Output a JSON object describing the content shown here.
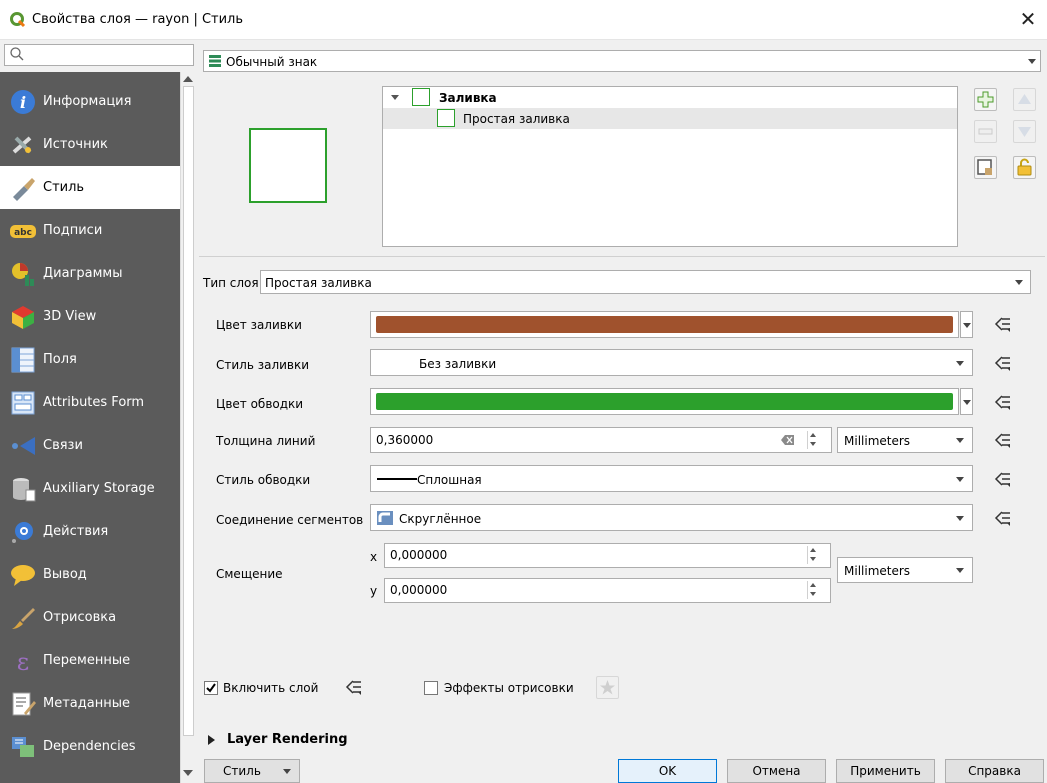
{
  "window": {
    "title": "Свойства слоя — rayon | Стиль",
    "close_glyph": "✕"
  },
  "search": {
    "placeholder": ""
  },
  "sidebar": {
    "items": [
      {
        "label": "Информация",
        "icon": "info-icon"
      },
      {
        "label": "Источник",
        "icon": "source-icon"
      },
      {
        "label": "Стиль",
        "icon": "paintbrush-icon",
        "active": true
      },
      {
        "label": "Подписи",
        "icon": "abc-labels-icon"
      },
      {
        "label": "Диаграммы",
        "icon": "diagram-icon"
      },
      {
        "label": "3D View",
        "icon": "cube-3d-icon"
      },
      {
        "label": "Поля",
        "icon": "fields-icon"
      },
      {
        "label": "Attributes Form",
        "icon": "form-icon"
      },
      {
        "label": "Связи",
        "icon": "join-icon"
      },
      {
        "label": "Auxiliary Storage",
        "icon": "database-icon"
      },
      {
        "label": "Действия",
        "icon": "actions-gear-icon"
      },
      {
        "label": "Вывод",
        "icon": "speech-bubble-icon"
      },
      {
        "label": "Отрисовка",
        "icon": "brush-icon"
      },
      {
        "label": "Переменные",
        "icon": "epsilon-icon"
      },
      {
        "label": "Метаданные",
        "icon": "metadata-icon"
      },
      {
        "label": "Dependencies",
        "icon": "dependencies-icon"
      }
    ]
  },
  "renderer": {
    "label": "Обычный знак"
  },
  "symbol_tree": {
    "root": "Заливка",
    "child": "Простая заливка"
  },
  "layer_type": {
    "label": "Тип слоя",
    "value": "Простая заливка"
  },
  "props": {
    "fill_color": {
      "label": "Цвет заливки",
      "color": "#a0522d"
    },
    "fill_style": {
      "label": "Стиль заливки",
      "value": "Без заливки"
    },
    "stroke_color": {
      "label": "Цвет обводки",
      "color": "#2ca02c"
    },
    "stroke_width": {
      "label": "Толщина линий",
      "value": "0,360000",
      "unit": "Millimeters"
    },
    "stroke_style": {
      "label": "Стиль обводки",
      "value": "Сплошная"
    },
    "join_style": {
      "label": "Соединение сегментов",
      "value": "Скруглённое"
    },
    "offset": {
      "label": "Смещение",
      "x_label": "x",
      "x_value": "0,000000",
      "y_label": "y",
      "y_value": "0,000000",
      "unit": "Millimeters"
    }
  },
  "bottom": {
    "enable_layer": {
      "label": "Включить слой",
      "checked": true
    },
    "draw_effects": {
      "label": "Эффекты отрисовки",
      "checked": false
    },
    "layer_rendering": "Layer Rendering"
  },
  "buttons": {
    "style": "Стиль",
    "ok": "OK",
    "cancel": "Отмена",
    "apply": "Применить",
    "help": "Справка"
  }
}
